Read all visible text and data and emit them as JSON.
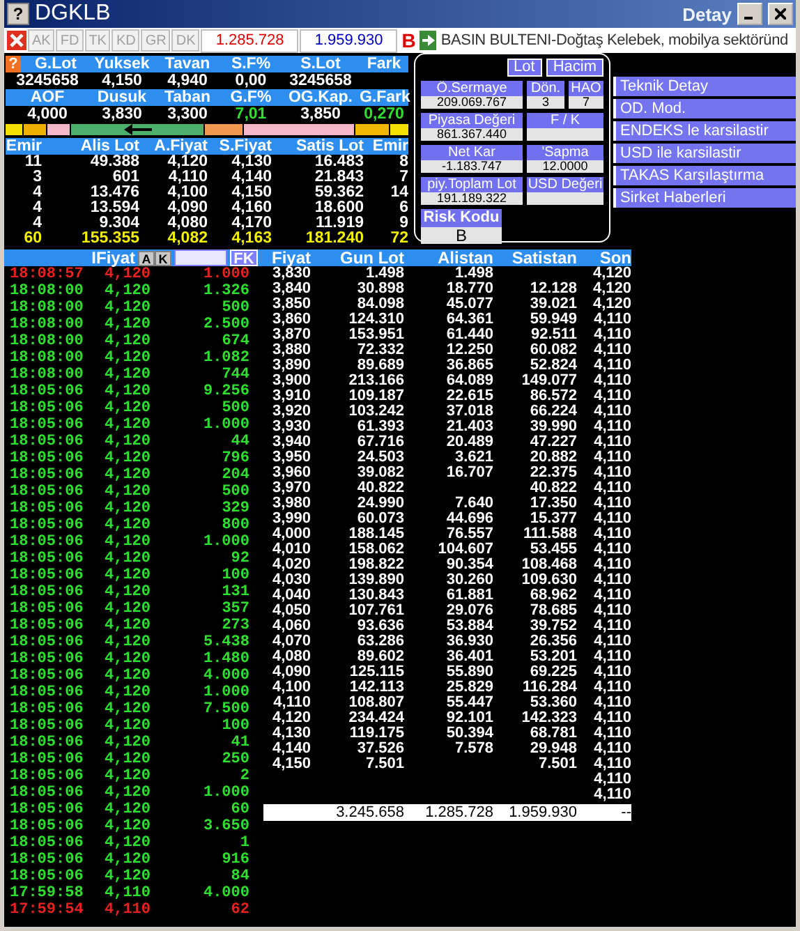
{
  "window": {
    "help": "?",
    "title": "DGKLB",
    "caption": "Detay"
  },
  "toolbar": {
    "tabs": [
      {
        "label": "AK",
        "selected": false
      },
      {
        "label": "FD",
        "selected": false
      },
      {
        "label": "TK",
        "selected": false
      },
      {
        "label": "KD",
        "selected": false
      },
      {
        "label": "GR",
        "selected": false
      },
      {
        "label": "DK",
        "selected": false
      }
    ],
    "buy_total": "1.285.728",
    "sell_total": "1.959.930",
    "flag": "B",
    "news": "BASIN BULTENI-Doğtaş Kelebek, mobilya sektöründ"
  },
  "summary_help": "?",
  "summary": [
    {
      "headers": [
        "G.Lot",
        "Yuksek",
        "Tavan",
        "S.F%",
        "S.Lot",
        "Fark"
      ],
      "values": [
        {
          "text": "3245658",
          "up": false
        },
        {
          "text": "4,150",
          "up": false
        },
        {
          "text": "4,940",
          "up": false
        },
        {
          "text": "0,00",
          "up": false
        },
        {
          "text": "3245658",
          "up": false
        }
      ]
    },
    {
      "headers": [
        "AOF",
        "Dusuk",
        "Taban",
        "G.F%",
        "OG.Kap.",
        "G.Fark"
      ],
      "values": [
        {
          "text": "4,000",
          "up": false
        },
        {
          "text": "3,830",
          "up": false
        },
        {
          "text": "3,300",
          "up": false
        },
        {
          "text": "7,01",
          "up": true
        },
        {
          "text": "3,850",
          "up": false
        },
        {
          "text": "0,270",
          "up": true
        }
      ]
    }
  ],
  "order_book": {
    "columns": [
      "Emir",
      "Alis Lot",
      "A.Fiyat",
      "S.Fiyat",
      "Satis Lot",
      "Emir"
    ],
    "rows": [
      [
        "11",
        "49.388",
        "4,120",
        "4,130",
        "16.483",
        "8"
      ],
      [
        "3",
        "601",
        "4,110",
        "4,140",
        "21.843",
        "7"
      ],
      [
        "4",
        "13.476",
        "4,100",
        "4,150",
        "59.362",
        "14"
      ],
      [
        "4",
        "13.594",
        "4,090",
        "4,160",
        "18.600",
        "6"
      ],
      [
        "4",
        "9.304",
        "4,080",
        "4,170",
        "11.919",
        "9"
      ]
    ],
    "totals": [
      "60",
      "155.355",
      "4,082",
      "4,163",
      "181.240",
      "72"
    ]
  },
  "detail": {
    "buttons": [
      "Lot",
      "Hacim"
    ],
    "rows": [
      [
        {
          "label": "Ö.Sermaye",
          "value": "209.069.767"
        },
        {
          "label": "Dön.",
          "value": "3"
        },
        {
          "label": "HAO",
          "value": "7"
        }
      ],
      [
        {
          "label": "Piyasa Değeri",
          "value": "861.367.440"
        },
        {
          "label": "F / K"
        }
      ],
      [
        {
          "label": "Net Kar",
          "value": "-1.183.747"
        },
        {
          "label": "'Sapma",
          "value": "12.0000"
        }
      ],
      [
        {
          "label": "piy.Toplam Lot",
          "value": "191.189.322"
        },
        {
          "label": "USD Değeri"
        }
      ]
    ],
    "risk": {
      "label": "Risk Kodu",
      "value": "B"
    }
  },
  "menu": [
    "Teknik Detay",
    "OD. Mod.",
    "ENDEKS le karsilastir",
    "USD ile karsilastir",
    "TAKAS Karşılaştırma",
    "Sirket Haberleri"
  ],
  "trades": {
    "header": "IFiyat",
    "buttons": [
      "A",
      "K"
    ],
    "filter": "FK",
    "rows": [
      {
        "time": "18:08:57",
        "price": "4,120",
        "lot": "1.000",
        "kind": "sell"
      },
      {
        "time": "18:08:00",
        "price": "4,120",
        "lot": "1.326",
        "kind": "buy"
      },
      {
        "time": "18:08:00",
        "price": "4,120",
        "lot": "500",
        "kind": "buy"
      },
      {
        "time": "18:08:00",
        "price": "4,120",
        "lot": "2.500",
        "kind": "buy"
      },
      {
        "time": "18:08:00",
        "price": "4,120",
        "lot": "674",
        "kind": "buy"
      },
      {
        "time": "18:08:00",
        "price": "4,120",
        "lot": "1.082",
        "kind": "buy"
      },
      {
        "time": "18:08:00",
        "price": "4,120",
        "lot": "744",
        "kind": "buy"
      },
      {
        "time": "18:05:06",
        "price": "4,120",
        "lot": "9.256",
        "kind": "buy"
      },
      {
        "time": "18:05:06",
        "price": "4,120",
        "lot": "500",
        "kind": "buy"
      },
      {
        "time": "18:05:06",
        "price": "4,120",
        "lot": "1.000",
        "kind": "buy"
      },
      {
        "time": "18:05:06",
        "price": "4,120",
        "lot": "44",
        "kind": "buy"
      },
      {
        "time": "18:05:06",
        "price": "4,120",
        "lot": "796",
        "kind": "buy"
      },
      {
        "time": "18:05:06",
        "price": "4,120",
        "lot": "204",
        "kind": "buy"
      },
      {
        "time": "18:05:06",
        "price": "4,120",
        "lot": "500",
        "kind": "buy"
      },
      {
        "time": "18:05:06",
        "price": "4,120",
        "lot": "329",
        "kind": "buy"
      },
      {
        "time": "18:05:06",
        "price": "4,120",
        "lot": "800",
        "kind": "buy"
      },
      {
        "time": "18:05:06",
        "price": "4,120",
        "lot": "1.000",
        "kind": "buy"
      },
      {
        "time": "18:05:06",
        "price": "4,120",
        "lot": "92",
        "kind": "buy"
      },
      {
        "time": "18:05:06",
        "price": "4,120",
        "lot": "100",
        "kind": "buy"
      },
      {
        "time": "18:05:06",
        "price": "4,120",
        "lot": "131",
        "kind": "buy"
      },
      {
        "time": "18:05:06",
        "price": "4,120",
        "lot": "357",
        "kind": "buy"
      },
      {
        "time": "18:05:06",
        "price": "4,120",
        "lot": "273",
        "kind": "buy"
      },
      {
        "time": "18:05:06",
        "price": "4,120",
        "lot": "5.438",
        "kind": "buy"
      },
      {
        "time": "18:05:06",
        "price": "4,120",
        "lot": "1.480",
        "kind": "buy"
      },
      {
        "time": "18:05:06",
        "price": "4,120",
        "lot": "4.000",
        "kind": "buy"
      },
      {
        "time": "18:05:06",
        "price": "4,120",
        "lot": "1.000",
        "kind": "buy"
      },
      {
        "time": "18:05:06",
        "price": "4,120",
        "lot": "7.500",
        "kind": "buy"
      },
      {
        "time": "18:05:06",
        "price": "4,120",
        "lot": "100",
        "kind": "buy"
      },
      {
        "time": "18:05:06",
        "price": "4,120",
        "lot": "41",
        "kind": "buy"
      },
      {
        "time": "18:05:06",
        "price": "4,120",
        "lot": "250",
        "kind": "buy"
      },
      {
        "time": "18:05:06",
        "price": "4,120",
        "lot": "2",
        "kind": "buy"
      },
      {
        "time": "18:05:06",
        "price": "4,120",
        "lot": "1.000",
        "kind": "buy"
      },
      {
        "time": "18:05:06",
        "price": "4,120",
        "lot": "60",
        "kind": "buy"
      },
      {
        "time": "18:05:06",
        "price": "4,120",
        "lot": "3.650",
        "kind": "buy"
      },
      {
        "time": "18:05:06",
        "price": "4,120",
        "lot": "1",
        "kind": "buy"
      },
      {
        "time": "18:05:06",
        "price": "4,120",
        "lot": "916",
        "kind": "buy"
      },
      {
        "time": "18:05:06",
        "price": "4,120",
        "lot": "84",
        "kind": "buy"
      },
      {
        "time": "17:59:58",
        "price": "4,110",
        "lot": "4.000",
        "kind": "buy"
      },
      {
        "time": "17:59:54",
        "price": "4,110",
        "lot": "62",
        "kind": "sell"
      }
    ]
  },
  "price_table": {
    "columns": [
      "Fiyat",
      "Gun Lot",
      "Alistan",
      "Satistan",
      "Son"
    ],
    "rows": [
      {
        "price": "3,830",
        "gun_lot": "1.498",
        "alistan": "1.498",
        "son": "4,120"
      },
      {
        "price": "3,840",
        "gun_lot": "30.898",
        "alistan": "18.770",
        "satistan": "12.128",
        "son": "4,120"
      },
      {
        "price": "3,850",
        "gun_lot": "84.098",
        "alistan": "45.077",
        "satistan": "39.021",
        "son": "4,120"
      },
      {
        "price": "3,860",
        "gun_lot": "124.310",
        "alistan": "64.361",
        "satistan": "59.949",
        "son": "4,110"
      },
      {
        "price": "3,870",
        "gun_lot": "153.951",
        "alistan": "61.440",
        "satistan": "92.511",
        "son": "4,110"
      },
      {
        "price": "3,880",
        "gun_lot": "72.332",
        "alistan": "12.250",
        "satistan": "60.082",
        "son": "4,110"
      },
      {
        "price": "3,890",
        "gun_lot": "89.689",
        "alistan": "36.865",
        "satistan": "52.824",
        "son": "4,110"
      },
      {
        "price": "3,900",
        "gun_lot": "213.166",
        "alistan": "64.089",
        "satistan": "149.077",
        "son": "4,110"
      },
      {
        "price": "3,910",
        "gun_lot": "109.187",
        "alistan": "22.615",
        "satistan": "86.572",
        "son": "4,110"
      },
      {
        "price": "3,920",
        "gun_lot": "103.242",
        "alistan": "37.018",
        "satistan": "66.224",
        "son": "4,110"
      },
      {
        "price": "3,930",
        "gun_lot": "61.393",
        "alistan": "21.403",
        "satistan": "39.990",
        "son": "4,110"
      },
      {
        "price": "3,940",
        "gun_lot": "67.716",
        "alistan": "20.489",
        "satistan": "47.227",
        "son": "4,110"
      },
      {
        "price": "3,950",
        "gun_lot": "24.503",
        "alistan": "3.621",
        "satistan": "20.882",
        "son": "4,110"
      },
      {
        "price": "3,960",
        "gun_lot": "39.082",
        "alistan": "16.707",
        "satistan": "22.375",
        "son": "4,110"
      },
      {
        "price": "3,970",
        "gun_lot": "40.822",
        "satistan": "40.822",
        "son": "4,110"
      },
      {
        "price": "3,980",
        "gun_lot": "24.990",
        "alistan": "7.640",
        "satistan": "17.350",
        "son": "4,110"
      },
      {
        "price": "3,990",
        "gun_lot": "60.073",
        "alistan": "44.696",
        "satistan": "15.377",
        "son": "4,110"
      },
      {
        "price": "4,000",
        "gun_lot": "188.145",
        "alistan": "76.557",
        "satistan": "111.588",
        "son": "4,110"
      },
      {
        "price": "4,010",
        "gun_lot": "158.062",
        "alistan": "104.607",
        "satistan": "53.455",
        "son": "4,110"
      },
      {
        "price": "4,020",
        "gun_lot": "198.822",
        "alistan": "90.354",
        "satistan": "108.468",
        "son": "4,110"
      },
      {
        "price": "4,030",
        "gun_lot": "139.890",
        "alistan": "30.260",
        "satistan": "109.630",
        "son": "4,110"
      },
      {
        "price": "4,040",
        "gun_lot": "130.843",
        "alistan": "61.881",
        "satistan": "68.962",
        "son": "4,110"
      },
      {
        "price": "4,050",
        "gun_lot": "107.761",
        "alistan": "29.076",
        "satistan": "78.685",
        "son": "4,110"
      },
      {
        "price": "4,060",
        "gun_lot": "93.636",
        "alistan": "53.884",
        "satistan": "39.752",
        "son": "4,110"
      },
      {
        "price": "4,070",
        "gun_lot": "63.286",
        "alistan": "36.930",
        "satistan": "26.356",
        "son": "4,110"
      },
      {
        "price": "4,080",
        "gun_lot": "89.602",
        "alistan": "36.401",
        "satistan": "53.201",
        "son": "4,110"
      },
      {
        "price": "4,090",
        "gun_lot": "125.115",
        "alistan": "55.890",
        "satistan": "69.225",
        "son": "4,110"
      },
      {
        "price": "4,100",
        "gun_lot": "142.113",
        "alistan": "25.829",
        "satistan": "116.284",
        "son": "4,110"
      },
      {
        "price": "4,110",
        "gun_lot": "108.807",
        "alistan": "55.447",
        "satistan": "53.360",
        "son": "4,110"
      },
      {
        "price": "4,120",
        "gun_lot": "234.424",
        "alistan": "92.101",
        "satistan": "142.323",
        "son": "4,110"
      },
      {
        "price": "4,130",
        "gun_lot": "119.175",
        "alistan": "50.394",
        "satistan": "68.781",
        "son": "4,110"
      },
      {
        "price": "4,140",
        "gun_lot": "37.526",
        "alistan": "7.578",
        "satistan": "29.948",
        "son": "4,110"
      },
      {
        "price": "4,150",
        "gun_lot": "7.501",
        "satistan": "7.501",
        "son": "4,110"
      },
      {
        "son": "4,110"
      },
      {
        "son": "4,110"
      }
    ],
    "totals": {
      "gun_lot": "3.245.658",
      "alistan": "1.285.728",
      "satistan": "1.959.930",
      "son": "--"
    }
  }
}
